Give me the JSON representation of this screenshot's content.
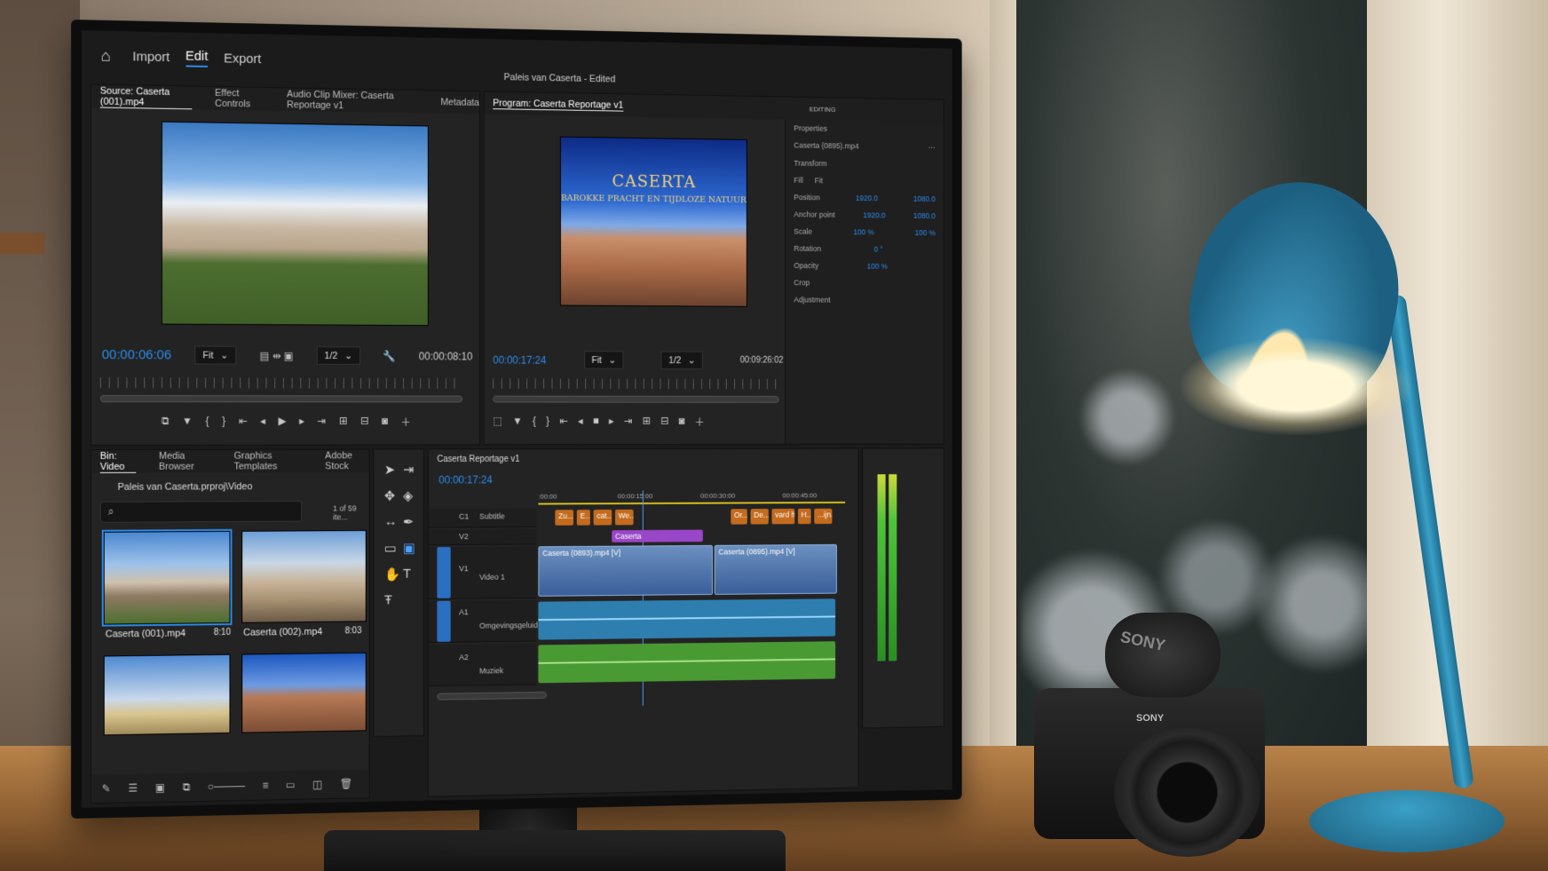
{
  "app": {
    "menu": [
      "Import",
      "Edit",
      "Export"
    ],
    "active_menu": "Edit",
    "project_title": "Paleis van Caserta - Edited"
  },
  "source_monitor": {
    "tabs": [
      "Source: Caserta (001).mp4",
      "Effect Controls",
      "Audio Clip Mixer: Caserta Reportage v1",
      "Metadata"
    ],
    "timecode": "00:00:06:06",
    "fit": "Fit",
    "resolution": "1/2",
    "duration": "00:00:08:10"
  },
  "program_monitor": {
    "tab": "Program: Caserta Reportage v1",
    "title_line1": "CASERTA",
    "title_line2": "BAROKKE PRACHT EN TIJDLOZE NATUUR",
    "timecode": "00:00:17:24",
    "fit": "Fit",
    "resolution": "1/2",
    "duration": "00:09:26:02",
    "editing_label": "EDITING"
  },
  "properties": {
    "title": "Properties",
    "clip": "Caserta (0895).mp4",
    "section": "Transform",
    "fill": "Fill",
    "fit": "Fit",
    "rows": [
      {
        "label": "Position",
        "value": "1920.0",
        "value2": "1080.0"
      },
      {
        "label": "Anchor point",
        "value": "1920.0",
        "value2": "1080.0"
      },
      {
        "label": "Scale",
        "value": "100 %",
        "value2": "100 %"
      },
      {
        "label": "Rotation",
        "value": "0 °",
        "value2": ""
      },
      {
        "label": "Opacity",
        "value": "100 %",
        "value2": ""
      }
    ],
    "crop": "Crop",
    "adjust": "Adjustment"
  },
  "bin": {
    "tabs": [
      "Bin: Video",
      "Media Browser",
      "Graphics Templates",
      "Adobe Stock"
    ],
    "path": "Paleis van Caserta.prproj\\Video",
    "count": "1 of 59 ite...",
    "items": [
      {
        "name": "Caserta (001).mp4",
        "duration": "8:10"
      },
      {
        "name": "Caserta (002).mp4",
        "duration": "8:03"
      },
      {
        "name": "",
        "duration": ""
      },
      {
        "name": "",
        "duration": ""
      }
    ]
  },
  "timeline": {
    "sequence": "Caserta Reportage v1",
    "timecode": "00:00:17:24",
    "ruler": [
      ":00:00",
      "00:00:15:00",
      "00:00:30:00",
      "00:00:45:00"
    ],
    "tracks": [
      {
        "id": "C1",
        "name": "Subtitle"
      },
      {
        "id": "V2",
        "name": ""
      },
      {
        "id": "V1",
        "name": "Video 1"
      },
      {
        "id": "A1",
        "name": "Omgevingsgeluid"
      },
      {
        "id": "A2",
        "name": "Muziek"
      }
    ],
    "subtitle_clips": [
      "Zu...",
      "E...",
      "cat...",
      "We...",
      "Or...",
      "De...",
      "vard hi...",
      "H...",
      "...ijn..."
    ],
    "graphic_clip": "Caserta",
    "video_clips": [
      "Caserta (0893).mp4 [V]",
      "Caserta (0895).mp4 [V]"
    ]
  },
  "colors": {
    "accent": "#2d8ceb",
    "subtitle_clip": "#c46b1d",
    "graphic_clip": "#9a46c8",
    "audio_clip": "#2e7fb0",
    "music_clip": "#4a9a33"
  },
  "photo": {
    "mic_brand": "SONY",
    "camera_brand": "SONY"
  }
}
